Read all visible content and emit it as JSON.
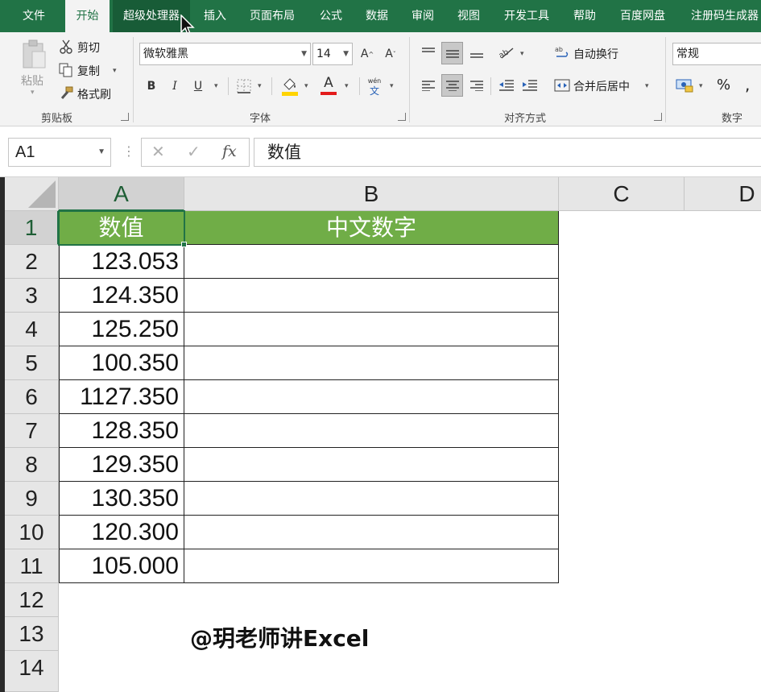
{
  "ribbon_tabs": [
    "文件",
    "开始",
    "超级处理器",
    "插入",
    "页面布局",
    "公式",
    "数据",
    "审阅",
    "视图",
    "开发工具",
    "帮助",
    "百度网盘",
    "注册码生成器"
  ],
  "clipboard": {
    "paste": "粘贴",
    "cut": "剪切",
    "copy": "复制",
    "format_painter": "格式刷",
    "group": "剪贴板"
  },
  "font": {
    "name": "微软雅黑",
    "size": "14",
    "bold": "B",
    "italic": "I",
    "underline": "U",
    "font_color_letter": "A",
    "phonetic": "wén",
    "phonetic_char": "文",
    "group": "字体"
  },
  "alignment": {
    "wrap_text": "自动换行",
    "merge_center": "合并后居中",
    "group": "对齐方式"
  },
  "number": {
    "format": "常规",
    "percent": "%",
    "group": "数字"
  },
  "formula_bar": {
    "name_box": "A1",
    "fx": "fx",
    "content": "数值"
  },
  "columns": [
    "A",
    "B",
    "C",
    "D"
  ],
  "rows": [
    "1",
    "2",
    "3",
    "4",
    "5",
    "6",
    "7",
    "8",
    "9",
    "10",
    "11",
    "12",
    "13",
    "14"
  ],
  "table": {
    "headers": [
      "数值",
      "中文数字"
    ],
    "values": [
      "123.053",
      "124.350",
      "125.250",
      "100.350",
      "1127.350",
      "128.350",
      "129.350",
      "130.350",
      "120.300",
      "105.000"
    ]
  },
  "watermark": "@玥老师讲Excel",
  "colors": {
    "excel_green": "#217346",
    "header_fill": "#70ad47",
    "header_text": "#ffffff"
  }
}
